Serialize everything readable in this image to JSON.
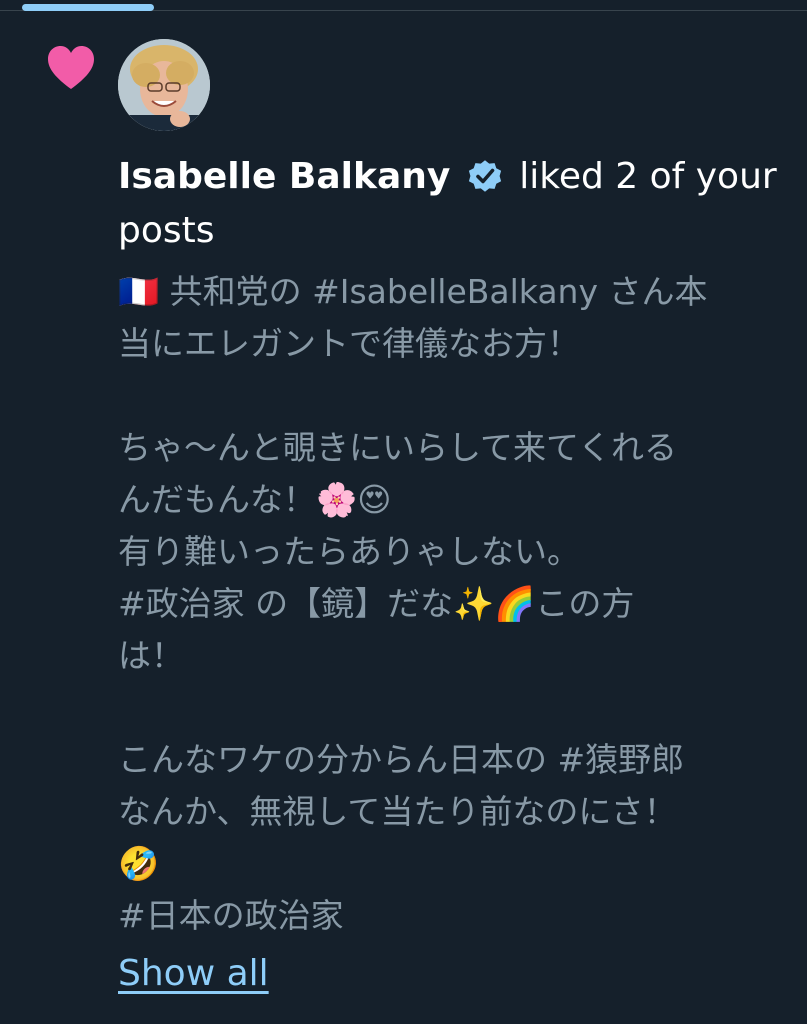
{
  "notification": {
    "user_name": "Isabelle Balkany",
    "action_text": "liked 2 of your posts",
    "show_all_label": "Show all"
  },
  "tweet": {
    "lines": [
      "🇫🇷 共和党の #IsabelleBalkany さん本",
      "当にエレガントで律儀なお方！",
      "",
      "ちゃ〜んと覗きにいらして来てくれる",
      "んだもんな！🌸😍",
      "有り難いったらありゃしない。",
      "#政治家 の【鏡】だな✨🌈この方",
      "は！",
      "",
      "こんなワケの分からん日本の #猿野郎",
      "なんか、無視して当たり前なのにさ！",
      "🤣",
      "#日本の政治家"
    ]
  },
  "icons": {
    "heart": "heart-icon",
    "verified": "verified-badge-icon"
  },
  "colors": {
    "background": "#15202b",
    "heart": "#f25ca8",
    "verified": "#8ecdf8",
    "link": "#8ecdf8",
    "secondary_text": "#8899a6"
  }
}
